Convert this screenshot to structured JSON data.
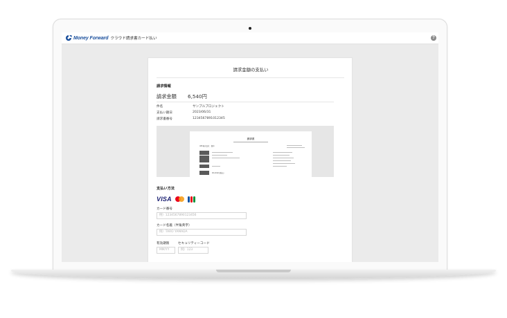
{
  "app": {
    "logo_text": "Money Forward",
    "product_name": "クラウド請求書カード払い",
    "help_glyph": "?"
  },
  "page": {
    "title": "請求金額の支払い",
    "invoice_section": {
      "heading": "請求情報",
      "amount_label": "請求金額",
      "amount_value": "6,540円",
      "rows": [
        {
          "label": "件名",
          "value": "サンプルプロジェクト"
        },
        {
          "label": "支払い期日",
          "value": "2023/06/31"
        },
        {
          "label": "請求書番号",
          "value": "1234567891012345"
        }
      ]
    },
    "invoice_preview": {
      "doc_title": "請求書",
      "recipient": "ABC株式会社　御中",
      "amount_box": "¥6,000円(税込)"
    },
    "payment_section": {
      "heading": "支払い方法",
      "brands": [
        "VISA",
        "Mastercard",
        "JCB"
      ],
      "card_number": {
        "label": "カード番号",
        "placeholder": "例）1234567890123456"
      },
      "card_name": {
        "label": "カード名義（半角英字）",
        "placeholder": "例）TARO YAMADA"
      },
      "expiry": {
        "label": "有効期限",
        "placeholder": "MM/YY"
      },
      "security_code": {
        "label": "セキュリティーコード",
        "placeholder": "例）123"
      }
    }
  },
  "colors": {
    "brand_blue": "#1a4f9c",
    "visa_blue": "#1a1f71",
    "mc_red": "#eb001b",
    "mc_yellow": "#f79e1b",
    "jcb_blue": "#0b4ea2",
    "jcb_red": "#e60012",
    "jcb_green": "#00913a"
  }
}
